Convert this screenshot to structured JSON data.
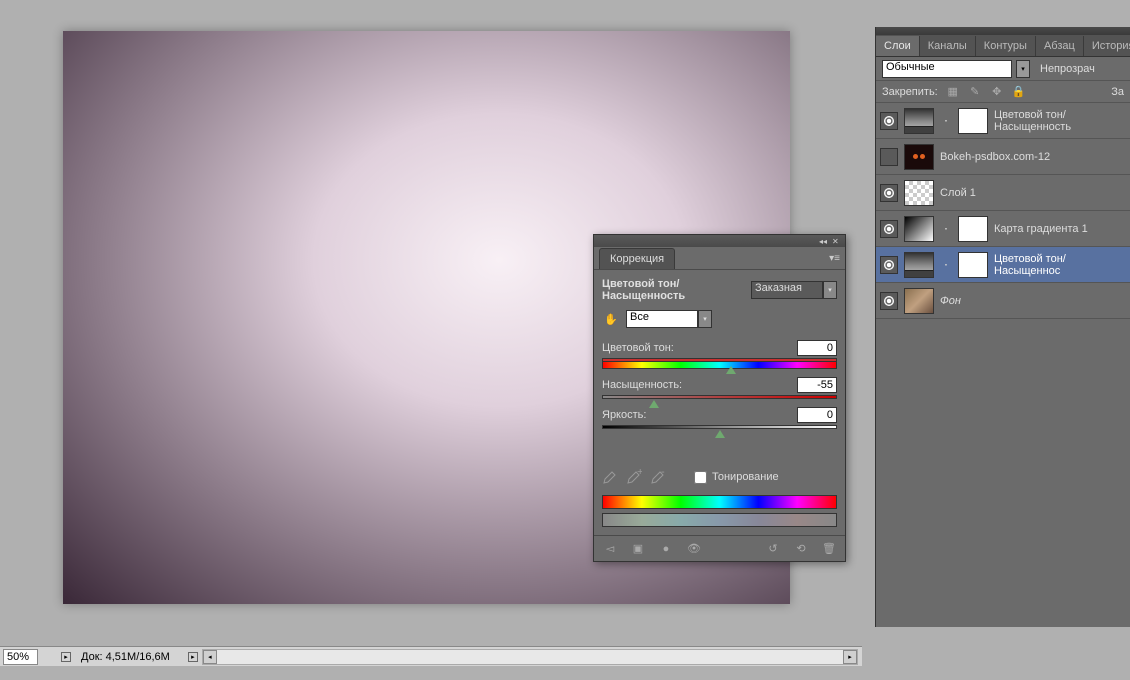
{
  "status": {
    "zoom": "50%",
    "doc_info": "Док: 4,51M/16,6M"
  },
  "adjustments": {
    "tab": "Коррекция",
    "title": "Цветовой тон/Насыщенность",
    "preset": "Заказная",
    "range": "Все",
    "hue_label": "Цветовой тон:",
    "hue_value": "0",
    "sat_label": "Насыщенность:",
    "sat_value": "-55",
    "light_label": "Яркость:",
    "light_value": "0",
    "colorize": "Тонирование"
  },
  "layers_panel": {
    "tabs": [
      "Слои",
      "Каналы",
      "Контуры",
      "Абзац",
      "История"
    ],
    "blend_mode": "Обычные",
    "opacity_label": "Непрозрач",
    "lock_label": "Закрепить:",
    "fill_label": "За",
    "layers": [
      {
        "name": "Цветовой тон/Насыщенность",
        "visible": true,
        "type": "adj",
        "hasMask": true
      },
      {
        "name": "Bokeh-psdbox.com-12",
        "visible": false,
        "type": "bokeh",
        "hasMask": false
      },
      {
        "name": "Слой 1",
        "visible": true,
        "type": "trans",
        "hasMask": false
      },
      {
        "name": "Карта градиента 1",
        "visible": true,
        "type": "grad",
        "hasMask": true
      },
      {
        "name": "Цветовой тон/Насыщеннос",
        "visible": true,
        "type": "adj",
        "hasMask": true,
        "selected": true
      },
      {
        "name": "Фон",
        "visible": true,
        "type": "photo",
        "hasMask": false,
        "italic": true
      }
    ]
  }
}
